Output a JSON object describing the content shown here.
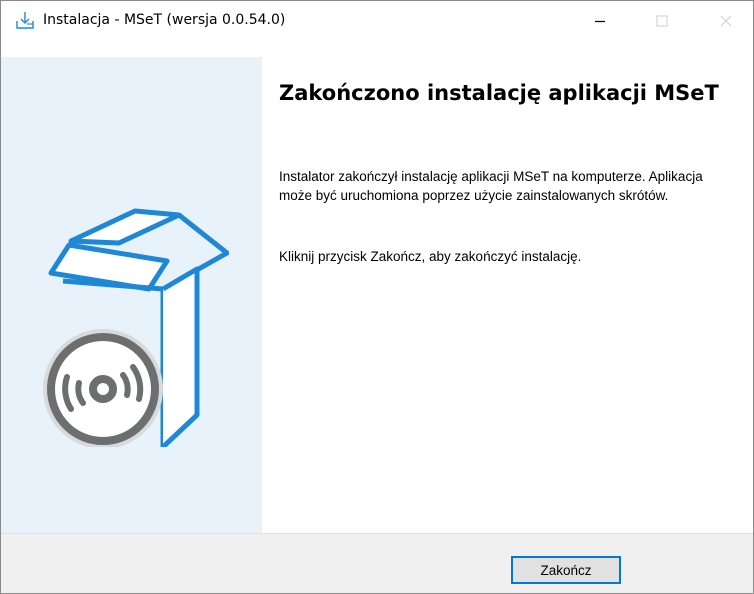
{
  "window": {
    "title": "Instalacja - MSeT (wersja 0.0.54.0)",
    "icon": "download-install-icon"
  },
  "title_controls": {
    "minimize_icon": "minimize-icon",
    "maximize_icon": "maximize-icon",
    "close_icon": "close-icon"
  },
  "banner": {
    "image": "software-box-with-disc-icon",
    "background": "#e8f2fa",
    "accent": "#1e88d6"
  },
  "content": {
    "heading": "Zakończono instalację aplikacji MSeT",
    "paragraph1": "Instalator zakończył instalację aplikacji MSeT na komputerze. Aplikacja może być uruchomiona poprzez użycie zainstalowanych skrótów.",
    "paragraph2": "Kliknij przycisk Zakończ, aby zakończyć instalację."
  },
  "footer": {
    "finish_label": "Zakończ",
    "focus_color": "#0078d7"
  }
}
